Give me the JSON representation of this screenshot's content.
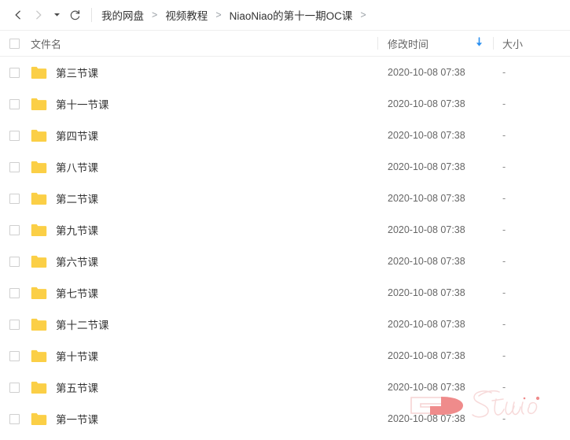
{
  "navbar": {
    "back_icon": "chevron-left-icon",
    "forward_icon": "chevron-right-icon",
    "history_caret_icon": "caret-down-icon",
    "refresh_icon": "refresh-icon",
    "breadcrumb": {
      "separator": ">",
      "items": [
        {
          "label": "我的网盘"
        },
        {
          "label": "视频教程"
        },
        {
          "label": "NiaoNiao的第十一期OC课"
        }
      ],
      "trailing_separator": ">"
    }
  },
  "list_header": {
    "name_label": "文件名",
    "time_label": "修改时间",
    "size_label": "大小",
    "sort_icon": "arrow-down-icon",
    "sort_direction": "desc",
    "sort_color": "#2a8ff0",
    "select_all_checked": false
  },
  "colors": {
    "folder_yellow": "#fbcf46",
    "folder_yellow_dark": "#f8c62f",
    "accent_blue": "#2a8ff0",
    "text_primary": "#333333",
    "text_secondary": "#666666",
    "border": "#eeeeee",
    "watermark_pink": "#ef8b8b"
  },
  "rows": [
    {
      "name": "第三节课",
      "time": "2020-10-08 07:38",
      "size": "-",
      "icon": "folder-icon",
      "checked": false
    },
    {
      "name": "第十一节课",
      "time": "2020-10-08 07:38",
      "size": "-",
      "icon": "folder-icon",
      "checked": false
    },
    {
      "name": "第四节课",
      "time": "2020-10-08 07:38",
      "size": "-",
      "icon": "folder-icon",
      "checked": false
    },
    {
      "name": "第八节课",
      "time": "2020-10-08 07:38",
      "size": "-",
      "icon": "folder-icon",
      "checked": false
    },
    {
      "name": "第二节课",
      "time": "2020-10-08 07:38",
      "size": "-",
      "icon": "folder-icon",
      "checked": false
    },
    {
      "name": "第九节课",
      "time": "2020-10-08 07:38",
      "size": "-",
      "icon": "folder-icon",
      "checked": false
    },
    {
      "name": "第六节课",
      "time": "2020-10-08 07:38",
      "size": "-",
      "icon": "folder-icon",
      "checked": false
    },
    {
      "name": "第七节课",
      "time": "2020-10-08 07:38",
      "size": "-",
      "icon": "folder-icon",
      "checked": false
    },
    {
      "name": "第十二节课",
      "time": "2020-10-08 07:38",
      "size": "-",
      "icon": "folder-icon",
      "checked": false
    },
    {
      "name": "第十节课",
      "time": "2020-10-08 07:38",
      "size": "-",
      "icon": "folder-icon",
      "checked": false
    },
    {
      "name": "第五节课",
      "time": "2020-10-08 07:38",
      "size": "-",
      "icon": "folder-icon",
      "checked": false
    },
    {
      "name": "第一节课",
      "time": "2020-10-08 07:38",
      "size": "-",
      "icon": "folder-icon",
      "checked": false
    }
  ],
  "watermark": {
    "text": "Studio",
    "color": "#ef8b8b"
  }
}
